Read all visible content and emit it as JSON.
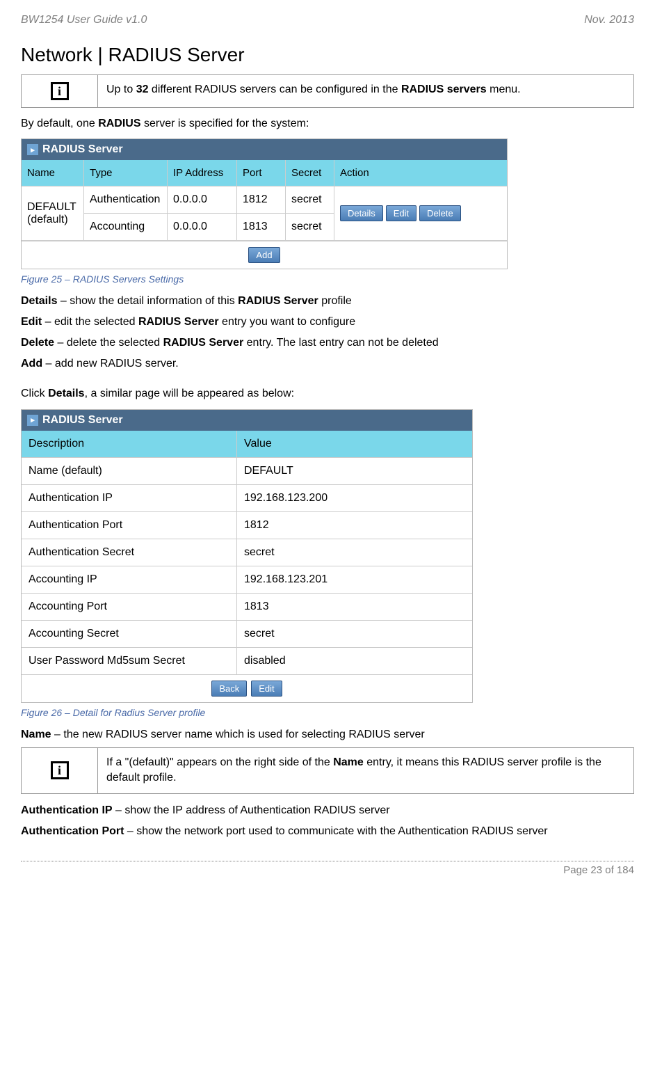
{
  "header": {
    "left": "BW1254 User Guide v1.0",
    "right": "Nov.  2013"
  },
  "section_title": "Network | RADIUS Server",
  "info1": {
    "pre": "Up to ",
    "bold1": "32",
    "mid": " different RADIUS servers can be configured in the ",
    "bold2": "RADIUS servers",
    "post": " menu."
  },
  "intro1": {
    "pre": "By default, one ",
    "bold": "RADIUS",
    "post": " server is specified for the system:"
  },
  "table1": {
    "title": "RADIUS Server",
    "cols": [
      "Name",
      "Type",
      "IP Address",
      "Port",
      "Secret",
      "Action"
    ],
    "name_cell": [
      "DEFAULT",
      "(default)"
    ],
    "rows": [
      {
        "type": "Authentication",
        "ip": "0.0.0.0",
        "port": "1812",
        "secret": "secret"
      },
      {
        "type": "Accounting",
        "ip": "0.0.0.0",
        "port": "1813",
        "secret": "secret"
      }
    ],
    "actions": [
      "Details",
      "Edit",
      "Delete"
    ],
    "add": "Add"
  },
  "fig25": "Figure 25 – RADIUS Servers Settings",
  "defs1": [
    {
      "term": "Details",
      "sep": " – show the detail information of this ",
      "bold": "RADIUS Server",
      "post": " profile"
    },
    {
      "term": "Edit",
      "sep": " – edit the selected ",
      "bold": "RADIUS Server",
      "post": " entry you want to configure"
    },
    {
      "term": "Delete",
      "sep": " – delete the selected ",
      "bold": "RADIUS Server",
      "post": " entry. The last entry can not be deleted"
    },
    {
      "term": "Add",
      "sep": " – add new RADIUS server.",
      "bold": "",
      "post": ""
    }
  ],
  "intro2": {
    "pre": "Click ",
    "bold": "Details",
    "post": ", a similar page will be appeared as below:"
  },
  "table2": {
    "title": "RADIUS Server",
    "header": [
      "Description",
      "Value"
    ],
    "rows": [
      [
        "Name   (default)",
        "DEFAULT"
      ],
      [
        "Authentication IP",
        "192.168.123.200"
      ],
      [
        "Authentication Port",
        "1812"
      ],
      [
        "Authentication Secret",
        "secret"
      ],
      [
        "Accounting IP",
        "192.168.123.201"
      ],
      [
        "Accounting Port",
        "1813"
      ],
      [
        "Accounting Secret",
        "secret"
      ],
      [
        "User Password Md5sum Secret",
        "disabled"
      ]
    ],
    "buttons": [
      "Back",
      "Edit"
    ]
  },
  "fig26": "Figure 26 – Detail for Radius Server profile",
  "name_def": {
    "term": "Name",
    "post": " – the new RADIUS server name which is used for selecting RADIUS server"
  },
  "info2": {
    "pre": "If a \"(default)\" appears on the right side of the ",
    "bold": "Name",
    "post": " entry, it means this RADIUS server profile is the default profile."
  },
  "defs2": [
    {
      "term": "Authentication IP",
      "post": " – show the IP address of Authentication RADIUS server"
    },
    {
      "term": "Authentication Port",
      "post": " – show the network port used to communicate with the Authentication RADIUS server"
    }
  ],
  "footer": "Page 23 of 184"
}
